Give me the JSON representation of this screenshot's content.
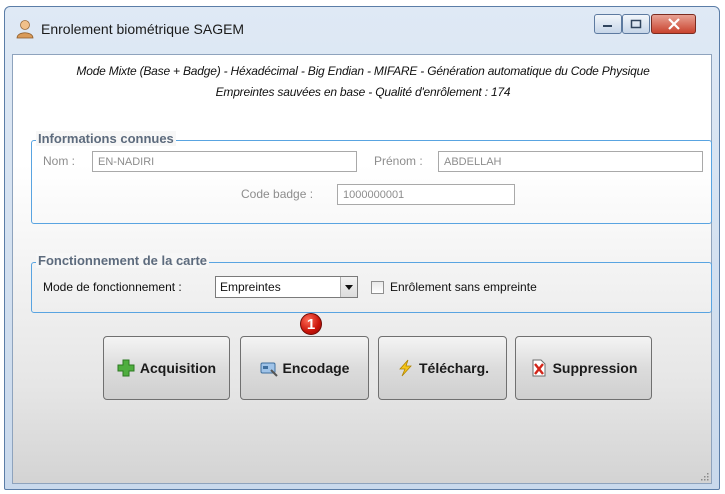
{
  "window": {
    "title": "Enrolement biométrique SAGEM",
    "controls": {
      "minimize": "minimize",
      "maximize": "maximize",
      "close": "close"
    }
  },
  "info": {
    "line1": "Mode Mixte (Base + Badge) - Héxadécimal - Big Endian - MIFARE - Génération automatique du Code Physique",
    "line2": "Empreintes sauvées en base - Qualité d'enrôlement : 174"
  },
  "known_info": {
    "title": "Informations connues",
    "nom_label": "Nom :",
    "nom_value": "EN-NADIRI",
    "prenom_label": "Prénom :",
    "prenom_value": "ABDELLAH",
    "badge_label": "Code badge :",
    "badge_value": "1000000001"
  },
  "card_mode": {
    "title": "Fonctionnement de la carte",
    "mode_label": "Mode de fonctionnement :",
    "mode_value": "Empreintes",
    "checkbox_label": "Enrôlement sans empreinte",
    "checkbox_checked": false
  },
  "actions": {
    "acquisition": "Acquisition",
    "encodage": "Encodage",
    "telecharg": "Télécharg.",
    "suppression": "Suppression",
    "annotation": "1"
  },
  "icons": {
    "app": "user-icon",
    "acquisition": "plus-icon",
    "encodage": "card-encode-icon",
    "telecharg": "lightning-icon",
    "suppression": "delete-icon"
  },
  "colors": {
    "group_border": "#59a4e1",
    "close_button": "#c9432e",
    "badge_red": "#c9140a"
  }
}
